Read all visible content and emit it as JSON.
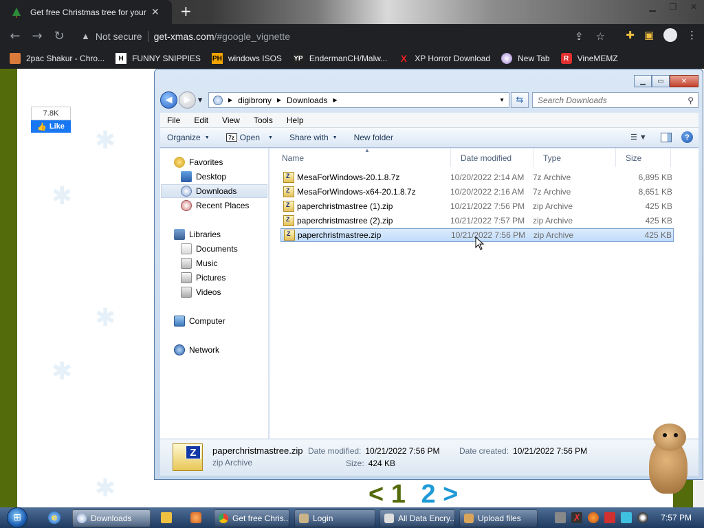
{
  "browser": {
    "tab_title": "Get free Christmas tree for your",
    "tab_close": "✕",
    "new_tab": "+",
    "security_label": "Not secure",
    "url_host": "get-xmas.com",
    "url_path": "/#google_vignette",
    "bookmarks": [
      {
        "label": "2pac Shakur - Chro...",
        "icon_text": "",
        "color": "#d97b3a"
      },
      {
        "label": "FUNNY SNIPPIES",
        "icon_text": "H",
        "color": "#ffffff"
      },
      {
        "label": "windows ISOS",
        "icon_text": "PH",
        "color": "#f0a400"
      },
      {
        "label": "EndermanCH/Malw...",
        "icon_text": "YP",
        "color": "#222222"
      },
      {
        "label": "XP Horror Download",
        "icon_text": "X",
        "color": "#e02020"
      },
      {
        "label": "New Tab",
        "icon_text": "",
        "color": "#9a7bd0"
      },
      {
        "label": "VineMEMZ",
        "icon_text": "R",
        "color": "#e03030"
      }
    ]
  },
  "page": {
    "fb_count": "7.8K",
    "fb_like": "Like",
    "pager_prev": "<",
    "pager_1": "1",
    "pager_2": "2",
    "pager_next": ">"
  },
  "explorer": {
    "breadcrumb": [
      "digibrony",
      "Downloads"
    ],
    "search_placeholder": "Search Downloads",
    "menu": [
      "File",
      "Edit",
      "View",
      "Tools",
      "Help"
    ],
    "commands": {
      "organize": "Organize",
      "open": "Open",
      "share": "Share with",
      "new_folder": "New folder"
    },
    "nav": {
      "favorites": "Favorites",
      "desktop": "Desktop",
      "downloads": "Downloads",
      "recent": "Recent Places",
      "libraries": "Libraries",
      "documents": "Documents",
      "music": "Music",
      "pictures": "Pictures",
      "videos": "Videos",
      "computer": "Computer",
      "network": "Network"
    },
    "columns": {
      "name": "Name",
      "date": "Date modified",
      "type": "Type",
      "size": "Size"
    },
    "files": [
      {
        "name": "MesaForWindows-20.1.8.7z",
        "date": "10/20/2022 2:14 AM",
        "type": "7z Archive",
        "size": "6,895 KB"
      },
      {
        "name": "MesaForWindows-x64-20.1.8.7z",
        "date": "10/20/2022 2:16 AM",
        "type": "7z Archive",
        "size": "8,651 KB"
      },
      {
        "name": "paperchristmastree (1).zip",
        "date": "10/21/2022 7:56 PM",
        "type": "zip Archive",
        "size": "425 KB"
      },
      {
        "name": "paperchristmastree (2).zip",
        "date": "10/21/2022 7:57 PM",
        "type": "zip Archive",
        "size": "425 KB"
      },
      {
        "name": "paperchristmastree.zip",
        "date": "10/21/2022 7:56 PM",
        "type": "zip Archive",
        "size": "425 KB"
      }
    ],
    "selected_index": 4,
    "details": {
      "filename": "paperchristmastree.zip",
      "type": "zip Archive",
      "modified_label": "Date modified:",
      "modified": "10/21/2022 7:56 PM",
      "created_label": "Date created:",
      "created": "10/21/2022 7:56 PM",
      "size_label": "Size:",
      "size": "424 KB"
    }
  },
  "taskbar": {
    "buttons": [
      {
        "label": "Downloads",
        "active": true
      },
      {
        "label": "Get free Chris...",
        "active": false
      },
      {
        "label": "Login",
        "active": false
      },
      {
        "label": "All Data Encry...",
        "active": false
      },
      {
        "label": "Upload files",
        "active": false
      }
    ],
    "clock": "7:57 PM"
  }
}
